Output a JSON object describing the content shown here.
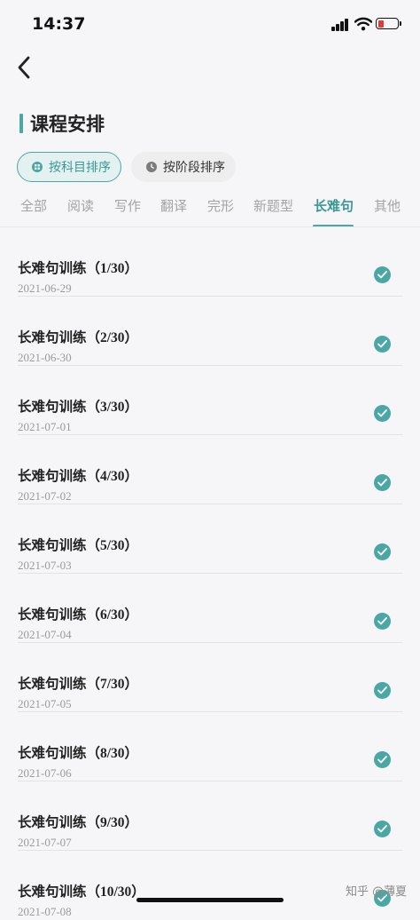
{
  "status_bar": {
    "time": "14:37",
    "icons": [
      "signal-icon",
      "wifi-icon",
      "battery-icon"
    ],
    "battery_color": "#e53935"
  },
  "nav": {
    "back_icon": "chevron-left-icon"
  },
  "page_title": "课程安排",
  "sort_buttons": {
    "by_subject": {
      "label": "按科目排序",
      "icon": "grid-icon",
      "active": true
    },
    "by_stage": {
      "label": "按阶段排序",
      "icon": "clock-icon",
      "active": false
    }
  },
  "tabs": [
    "全部",
    "阅读",
    "写作",
    "翻译",
    "完形",
    "新题型",
    "长难句",
    "其他"
  ],
  "active_tab": "长难句",
  "lessons": [
    {
      "title": "长难句训练（1/30）",
      "date": "2021-06-29",
      "completed": true
    },
    {
      "title": "长难句训练（2/30）",
      "date": "2021-06-30",
      "completed": true
    },
    {
      "title": "长难句训练（3/30）",
      "date": "2021-07-01",
      "completed": true
    },
    {
      "title": "长难句训练（4/30）",
      "date": "2021-07-02",
      "completed": true
    },
    {
      "title": "长难句训练（5/30）",
      "date": "2021-07-03",
      "completed": true
    },
    {
      "title": "长难句训练（6/30）",
      "date": "2021-07-04",
      "completed": true
    },
    {
      "title": "长难句训练（7/30）",
      "date": "2021-07-05",
      "completed": true
    },
    {
      "title": "长难句训练（8/30）",
      "date": "2021-07-06",
      "completed": true
    },
    {
      "title": "长难句训练（9/30）",
      "date": "2021-07-07",
      "completed": true
    },
    {
      "title": "长难句训练（10/30）",
      "date": "2021-07-08",
      "completed": true
    }
  ],
  "watermark": "知乎 @薄夏",
  "colors": {
    "accent": "#4aa7a5",
    "accent_light": "#e3f2f1",
    "background": "#f6f6f8"
  }
}
